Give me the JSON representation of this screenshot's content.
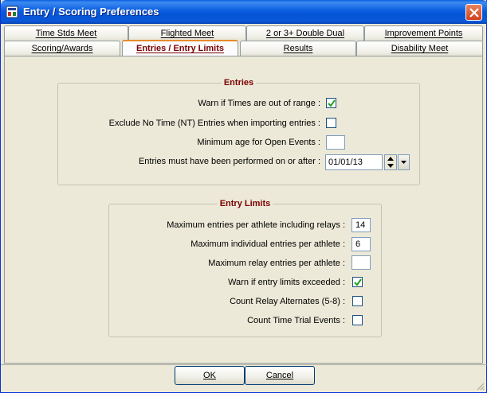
{
  "window": {
    "title": "Entry / Scoring Preferences"
  },
  "tabs_row1": [
    {
      "label": "Time Stds Meet"
    },
    {
      "label": "Flighted Meet"
    },
    {
      "label": "2 or 3+ Double Dual"
    },
    {
      "label": "Improvement Points"
    }
  ],
  "tabs_row2": [
    {
      "label": "Scoring/Awards"
    },
    {
      "label": "Entries / Entry Limits",
      "active": true
    },
    {
      "label": "Results"
    },
    {
      "label": "Disability Meet"
    }
  ],
  "entries": {
    "title": "Entries",
    "warn_range_label": "Warn if Times are out of range :",
    "warn_range_checked": true,
    "exclude_nt_label": "Exclude No Time (NT) Entries when importing entries :",
    "exclude_nt_checked": false,
    "min_age_label": "Minimum age for Open Events :",
    "min_age_value": "",
    "performed_after_label": "Entries must have been performed on or after :",
    "performed_after_value": "01/01/13"
  },
  "limits": {
    "title": "Entry Limits",
    "max_entries_label": "Maximum entries per athlete including relays :",
    "max_entries_value": "14",
    "max_individual_label": "Maximum individual entries per athlete :",
    "max_individual_value": "6",
    "max_relay_label": "Maximum relay entries per athlete :",
    "max_relay_value": "",
    "warn_exceeded_label": "Warn if entry limits exceeded :",
    "warn_exceeded_checked": true,
    "count_alternates_label": "Count Relay Alternates (5-8) :",
    "count_alternates_checked": false,
    "count_time_trial_label": "Count Time Trial Events :",
    "count_time_trial_checked": false
  },
  "buttons": {
    "ok_label": "OK",
    "cancel_label": "Cancel"
  },
  "colors": {
    "accent": "#7a0000",
    "titlebar": "#0554d8",
    "active_tab_marker": "#e68b2c"
  }
}
